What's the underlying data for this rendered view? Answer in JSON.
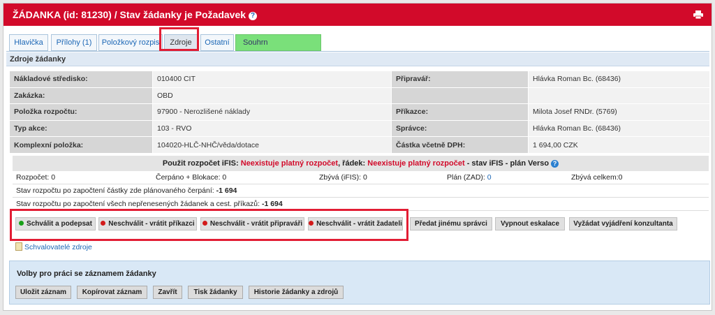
{
  "header": {
    "title": "ŽÁDANKA (id: 81230) / Stav žádanky je Požadavek",
    "info_icon": "info-icon",
    "print_icon": "printer-icon"
  },
  "tabs": [
    {
      "label": "Hlavička"
    },
    {
      "label": "Přílohy (1)"
    },
    {
      "label": "Položkový rozpis"
    },
    {
      "label": "Zdroje"
    },
    {
      "label": "Ostatní"
    },
    {
      "label": "Souhrn"
    }
  ],
  "section_title": "Zdroje žádanky",
  "fields": {
    "cost_center_label": "Nákladové středisko:",
    "cost_center_value": "010400 CIT",
    "preparer_label": "Připravář:",
    "preparer_value": "Hlávka Roman Bc. (68436)",
    "order_label": "Zakázka:",
    "order_value": "OBD",
    "budget_item_label": "Položka rozpočtu:",
    "budget_item_value": "97900 - Nerozlišené náklady",
    "initiator_label": "Příkazce:",
    "initiator_value": "Milota Josef RNDr. (5769)",
    "action_type_label": "Typ akce:",
    "action_type_value": "103 - RVO",
    "administrator_label": "Správce:",
    "administrator_value": "Hlávka Roman Bc. (68436)",
    "complex_item_label": "Komplexní položka:",
    "complex_item_value": "104020-HLČ-NHČ/věda/dotace",
    "amount_label": "Částka včetně DPH:",
    "amount_value": "1 694,00 CZK"
  },
  "budget": {
    "heading_prefix": "Použit rozpočet iFIS:",
    "heading_budget": "Neexistuje platný rozpočet",
    "heading_row_label": ", řádek:",
    "heading_row": "Neexistuje platný rozpočet",
    "heading_suffix": "- stav iFIS - plán Verso",
    "rozpocet": "Rozpočet: 0",
    "cerpano": "Čerpáno + Blokace: 0",
    "zbyva_ifis": "Zbývá (iFIS): 0",
    "plan_label": "Plán (ZAD):",
    "plan_value": "0",
    "zbyva_celkem": "Zbývá celkem:0",
    "stav1_text": "Stav rozpočtu po započtení částky zde plánovaného čerpání:",
    "stav1_value": "-1 694",
    "stav2_text": "Stav rozpočtu po započtení všech nepřenesených žádanek a cest. příkazů:",
    "stav2_value": "-1 694"
  },
  "actions": {
    "approve": "Schválit a podepsat",
    "reject_initiator": "Neschválit - vrátit příkazci",
    "reject_preparer": "Neschválit - vrátit připraváři",
    "reject_requester": "Neschválit - vrátit žadateli",
    "forward": "Předat jinému správci",
    "disable_escalation": "Vypnout eskalace",
    "request_opinion": "Vyžádat vyjádření konzultanta"
  },
  "approvers_link": "Schvalovatelé zdroje",
  "options": {
    "title": "Volby pro práci se záznamem žádanky",
    "save": "Uložit záznam",
    "copy": "Kopírovat záznam",
    "close": "Zavřít",
    "print": "Tisk žádanky",
    "history": "Historie žádanky a zdrojů"
  },
  "colors": {
    "header_red": "#d20a2a",
    "highlight_red": "#e21d34",
    "summary_tab_green": "#7ae07a",
    "link_blue": "#1b66b5"
  }
}
